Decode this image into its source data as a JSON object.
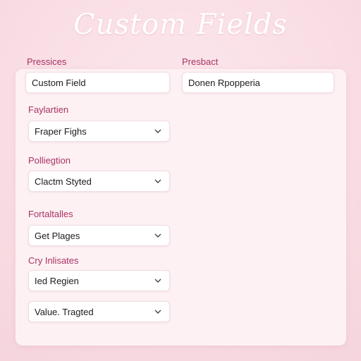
{
  "page": {
    "title": "Custom Fields"
  },
  "left_column": {
    "field1": {
      "label": "Pressices",
      "value": "Custom Field"
    },
    "field2": {
      "label": "Faylartien",
      "value": "Fraper Fighs",
      "icon": "chevron-down-icon"
    },
    "field3": {
      "label": "Polliegtion",
      "value": "Clactm Styted",
      "icon": "chevron-down-icon"
    },
    "field4": {
      "label": "Fortaltalles",
      "value": "Get Plages",
      "icon": "chevron-down-icon"
    },
    "field5": {
      "label": "Cry Inlisates",
      "value": "Ied Regien",
      "icon": "chevron-down-icon"
    },
    "field6": {
      "value": "Value. Tragted",
      "icon": "chevron-down-icon"
    }
  },
  "right_column": {
    "field1": {
      "label": "Presbact",
      "value": "Donen Rpopperia"
    }
  },
  "colors": {
    "label": "#a83262",
    "background": "#f9dde4",
    "panel": "#fdf1f4",
    "field": "#ffffff"
  }
}
